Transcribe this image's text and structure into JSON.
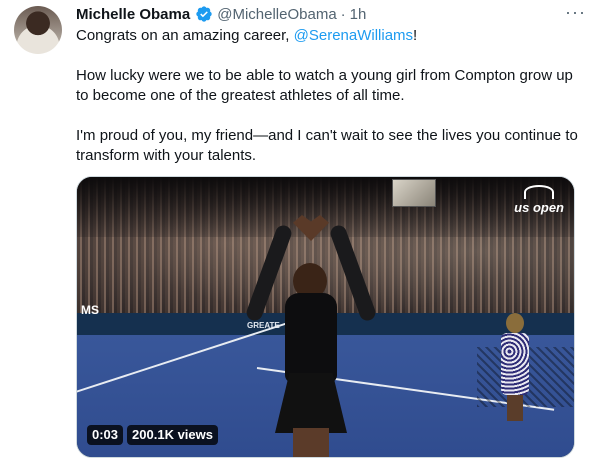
{
  "tweet": {
    "author_name": "Michelle Obama",
    "handle": "@MichelleObama",
    "separator": "·",
    "time": "1h",
    "more_icon": "more-horizontal-icon",
    "text_line1_prefix": "Congrats on an amazing career, ",
    "text_line1_mention": "@SerenaWilliams",
    "text_line1_suffix": "!",
    "paragraph2": "How lucky were we to be able to watch a young girl from Compton grow up to become one of the greatest athletes of all time.",
    "paragraph3": "I'm proud of you, my friend—and I can't wait to see the lives you continue to transform with your talents."
  },
  "media": {
    "brand_logo": "us open",
    "banner_text": "GREATE",
    "edge_text": "MS",
    "video_time": "0:03",
    "view_count": "200.1K views"
  },
  "colors": {
    "accent": "#1d9bf0",
    "text": "#0f1419",
    "muted": "#536471"
  }
}
